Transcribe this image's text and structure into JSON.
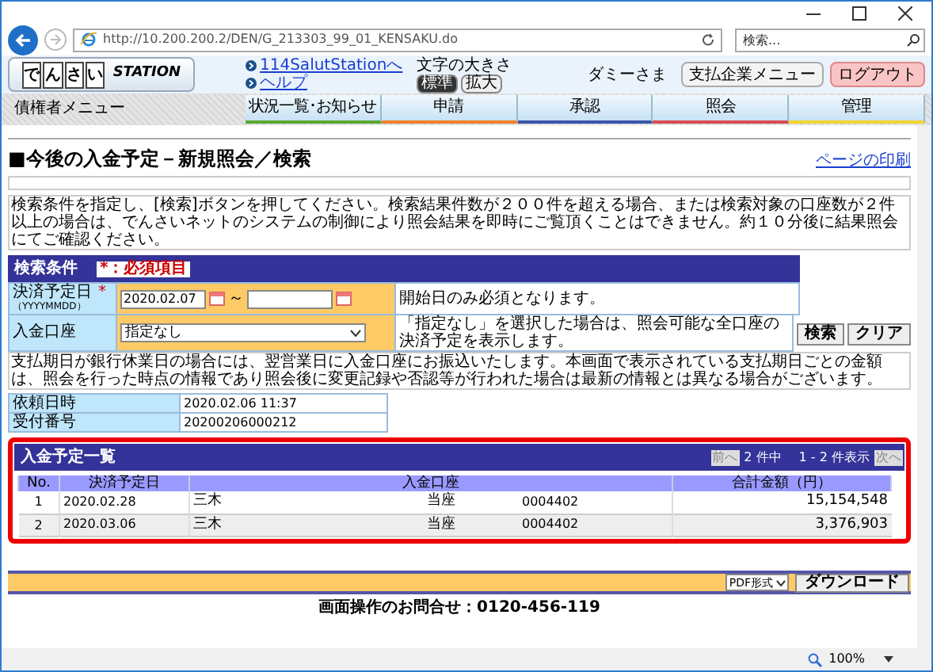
{
  "browser": {
    "url": "http://10.200.200.2/DEN/G_213303_99_01_KENSAKU.do",
    "search_placeholder": "検索...",
    "zoom": "100%"
  },
  "header": {
    "logo": [
      "で",
      "ん",
      "さ",
      "い"
    ],
    "logo_text": "STATION",
    "links": [
      "114SalutStationへ",
      "ヘルプ"
    ],
    "font_size_label": "文字の大きさ",
    "font_sizes": [
      {
        "label": "標準",
        "selected": true
      },
      {
        "label": "拡大",
        "selected": false
      }
    ],
    "user": "ダミーさま",
    "buttons": [
      {
        "label": "支払企業メニュー",
        "kind": "normal"
      },
      {
        "label": "ログアウト",
        "kind": "logout"
      }
    ]
  },
  "nav": {
    "menu_title": "債権者メニュー",
    "tabs": [
      {
        "label": "状況一覧･お知らせ",
        "color": "#5aa832"
      },
      {
        "label": "申請",
        "color": "#f0802a"
      },
      {
        "label": "承認",
        "color": "#3a55a8"
      },
      {
        "label": "照会",
        "color": "#d84a50"
      },
      {
        "label": "管理",
        "color": "#f2d530"
      }
    ]
  },
  "page": {
    "title": "■今後の入金予定－新規照会／検索",
    "print_link": "ページの印刷",
    "notice": "検索条件を指定し、[検索]ボタンを押してください。検索結果件数が２００件を超える場合、または検索対象の口座数が２件以上の場合は、でんさいネットのシステムの制御により照会結果を即時にご覧頂くことはできません。約１０分後に結果照会にてご確認ください。"
  },
  "search": {
    "title": "検索条件",
    "required_legend": "*：必須項目",
    "date": {
      "label": "決済予定日",
      "required": "*",
      "format": "（YYYYMMDD）",
      "from": "2020.02.07",
      "separator": "～",
      "hint": "開始日のみ必須となります。"
    },
    "account": {
      "label": "入金口座",
      "value": "指定なし",
      "hint": "「指定なし」を選択した場合は、照会可能な全口座の決済予定を表示します。"
    },
    "buttons": [
      "検索",
      "クリア"
    ],
    "note": "支払期日が銀行休業日の場合には、翌営業日に入金口座にお振込いたします。本画面で表示されている支払期日ごとの金額は、照会を行った時点の情報であり照会後に変更記録や否認等が行われた場合は最新の情報とは異なる場合がございます。"
  },
  "request_info": [
    {
      "label": "依頼日時",
      "value": "2020.02.06 11:37"
    },
    {
      "label": "受付番号",
      "value": "20200206000212"
    }
  ],
  "results": {
    "title": "入金予定一覧",
    "prev": "前へ",
    "count": "2 件中",
    "range": "1 - 2 件表示",
    "next": "次へ",
    "columns": [
      "No.",
      "決済予定日",
      "入金口座",
      "合計金額（円）"
    ],
    "rows": [
      {
        "no": "1",
        "date": "2020.02.28",
        "bank": "三木",
        "account_type": "当座",
        "account_number": "0004402",
        "total": "15,154,548"
      },
      {
        "no": "2",
        "date": "2020.03.06",
        "bank": "三木",
        "account_type": "当座",
        "account_number": "0004402",
        "total": "3,376,903"
      }
    ]
  },
  "download": {
    "format": "PDF形式",
    "button": "ダウンロード"
  },
  "footer": "画面操作のお問合せ：0120-456-119"
}
